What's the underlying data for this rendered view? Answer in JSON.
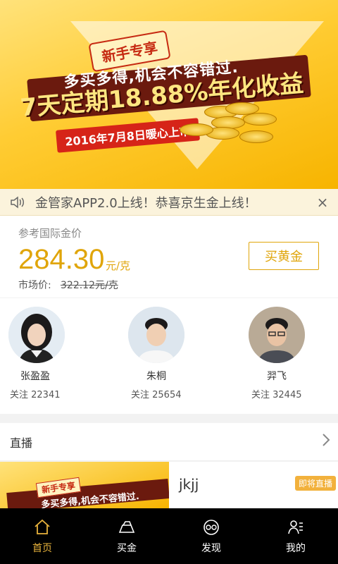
{
  "banner": {
    "tag": "新手专享",
    "line1": "多买多得,机会不容错过.",
    "line2": "7天定期18.88%年化收益",
    "date": "2016年7月8日暖心上市"
  },
  "notice": {
    "text": "金管家APP2.0上线！恭喜京生金上线！",
    "close": "×",
    "speaker_icon": "speaker-icon"
  },
  "price": {
    "label": "参考国际金价",
    "value": "284.30",
    "unit": "元/克",
    "market_label": "市场价:",
    "market_value": "322.12元/克",
    "buy_label": "买黄金"
  },
  "analysts": [
    {
      "name": "张盈盈",
      "follow": "关注  22341"
    },
    {
      "name": "朱桐",
      "follow": "关注  25654"
    },
    {
      "name": "羿飞",
      "follow": "关注  32445"
    }
  ],
  "live": {
    "header": "直播",
    "item_title": "jkjj",
    "item_badge": "即将直播",
    "thumb_tag": "新手专享",
    "thumb_line": "多买多得,机会不容错过."
  },
  "nav": [
    {
      "label": "首页",
      "icon": "home-icon",
      "active": true
    },
    {
      "label": "买金",
      "icon": "gold-bar-icon",
      "active": false
    },
    {
      "label": "发现",
      "icon": "discover-icon",
      "active": false
    },
    {
      "label": "我的",
      "icon": "profile-icon",
      "active": false
    }
  ],
  "colors": {
    "accent": "#e0a50a",
    "nav_active": "#e9b33c",
    "nav_bg": "#000000"
  }
}
